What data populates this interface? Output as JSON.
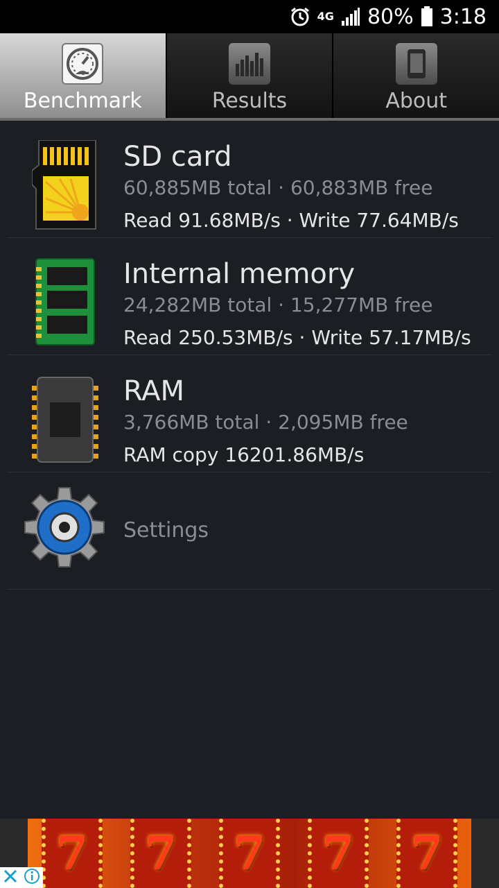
{
  "status_bar": {
    "network": "4G",
    "battery": "80%",
    "time": "3:18"
  },
  "tabs": [
    {
      "label": "Benchmark",
      "icon": "speedometer-icon",
      "active": true
    },
    {
      "label": "Results",
      "icon": "bar-chart-icon",
      "active": false
    },
    {
      "label": "About",
      "icon": "phone-icon",
      "active": false
    }
  ],
  "items": [
    {
      "title": "SD card",
      "subtitle": "60,885MB total · 60,883MB free",
      "speed": "Read 91.68MB/s · Write 77.64MB/s",
      "icon": "sd-card-icon"
    },
    {
      "title": "Internal memory",
      "subtitle": "24,282MB total · 15,277MB free",
      "speed": "Read 250.53MB/s · Write 57.17MB/s",
      "icon": "memory-chip-icon"
    },
    {
      "title": "RAM",
      "subtitle": "3,766MB total · 2,095MB free",
      "speed": "RAM copy 16201.86MB/s",
      "icon": "ram-chip-icon"
    },
    {
      "title": "Settings",
      "icon": "gear-icon"
    }
  ],
  "ad": {
    "slot_symbols": [
      "7",
      "7",
      "7",
      "7",
      "7"
    ]
  },
  "colors": {
    "background": "#1b1e23",
    "text_primary": "#e6e6e6",
    "text_secondary": "#8a8d92"
  }
}
